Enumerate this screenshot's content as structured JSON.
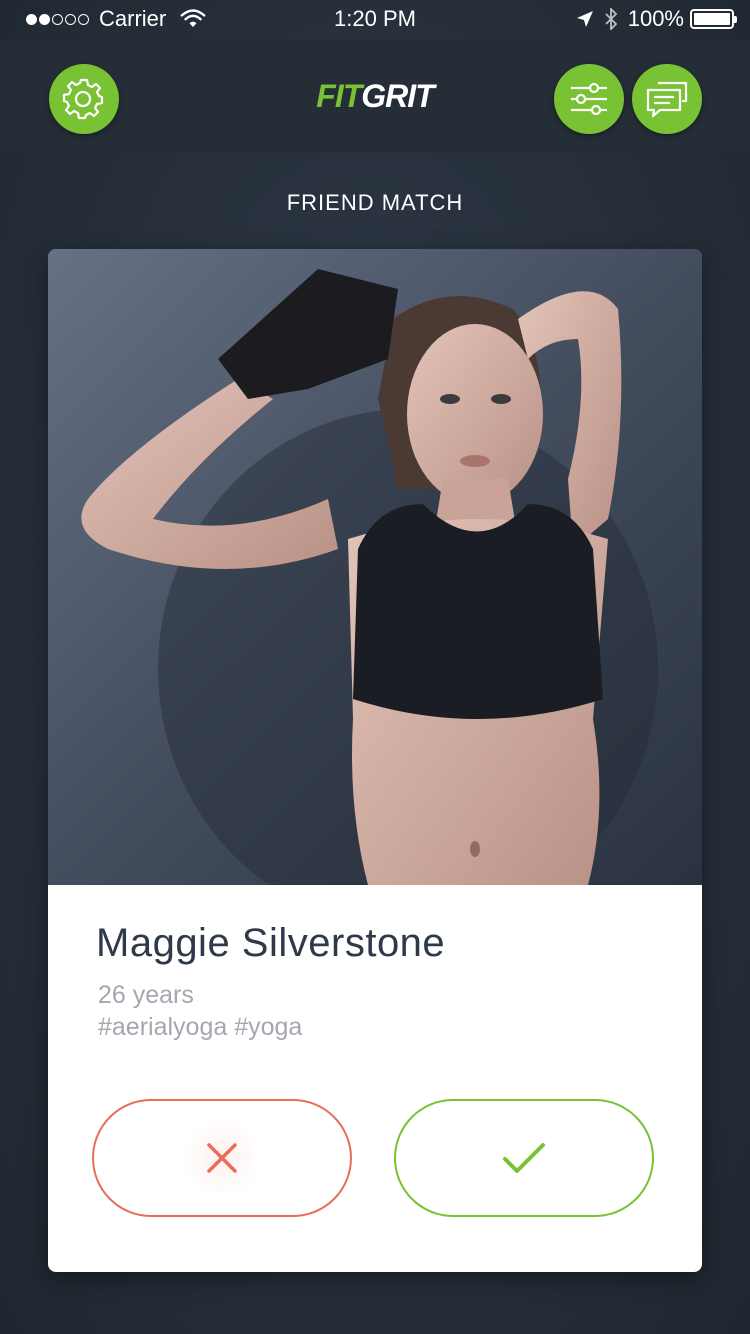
{
  "status_bar": {
    "carrier": "Carrier",
    "time": "1:20 PM",
    "battery": "100%"
  },
  "header": {
    "logo_part1": "FIT",
    "logo_part2": "GRIT",
    "settings_icon": "gear-icon",
    "filter_icon": "sliders-icon",
    "chat_icon": "chat-bubbles-icon"
  },
  "page": {
    "title": "FRIEND MATCH"
  },
  "profile": {
    "name": "Maggie Silverstone",
    "age": "26 years",
    "tags": "#aerialyoga #yoga"
  },
  "actions": {
    "reject_icon": "close-icon",
    "accept_icon": "checkmark-icon"
  },
  "colors": {
    "accent_green": "#78c234",
    "reject_red": "#e86e5a",
    "background": "#27303b",
    "card": "#ffffff"
  }
}
